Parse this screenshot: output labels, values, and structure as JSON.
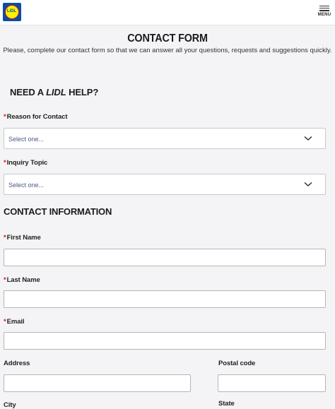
{
  "header": {
    "logo_text": "LiDL",
    "menu_label": "MENU"
  },
  "page": {
    "title": "CONTACT FORM",
    "subtitle": "Please, complete our contact form so that we can answer all your questions, requests and suggestions quickly."
  },
  "help_section": {
    "heading_prefix": "NEED A ",
    "heading_brand": "LIDL",
    "heading_suffix": " HELP?",
    "reason": {
      "required_mark": "*",
      "label": "Reason for Contact",
      "value": "Select one..."
    },
    "topic": {
      "required_mark": "*",
      "label": "Inquiry Topic",
      "value": "Select one..."
    }
  },
  "contact_section": {
    "heading": "CONTACT INFORMATION",
    "first_name": {
      "required_mark": "*",
      "label": "First Name",
      "value": ""
    },
    "last_name": {
      "required_mark": "*",
      "label": "Last Name",
      "value": ""
    },
    "email": {
      "required_mark": "*",
      "label": "Email",
      "value": ""
    },
    "address": {
      "label": "Address",
      "value": ""
    },
    "postal_code": {
      "label": "Postal code",
      "value": ""
    },
    "city": {
      "label": "City"
    },
    "state": {
      "label": "State"
    }
  },
  "colors": {
    "background": "#f4f4f6",
    "required": "#e60a14",
    "brand_blue": "#0050aa",
    "brand_yellow": "#fff200"
  }
}
